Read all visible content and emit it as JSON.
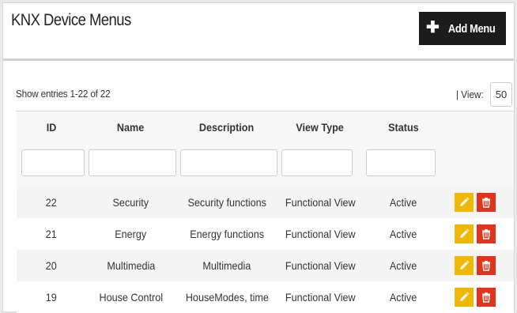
{
  "header": {
    "title": "KNX Device Menus",
    "add_button_label": "Add Menu"
  },
  "toolbar": {
    "entries_info": "Show entries 1-22 of 22",
    "view_label": "| View:",
    "view_value": "50"
  },
  "table": {
    "columns": [
      "ID",
      "Name",
      "Description",
      "View Type",
      "Status"
    ],
    "rows": [
      {
        "id": "22",
        "name": "Security",
        "description": "Security functions",
        "view_type": "Functional View",
        "status": "Active"
      },
      {
        "id": "21",
        "name": "Energy",
        "description": "Energy functions",
        "view_type": "Functional View",
        "status": "Active"
      },
      {
        "id": "20",
        "name": "Multimedia",
        "description": "Multimedia",
        "view_type": "Functional View",
        "status": "Active"
      },
      {
        "id": "19",
        "name": "House Control",
        "description": "HouseModes, time",
        "view_type": "Functional View",
        "status": "Active"
      }
    ]
  },
  "icons": {
    "add": "plus-icon",
    "edit": "pencil-icon",
    "delete": "trash-icon"
  },
  "colors": {
    "add_button": "#1c1c1c",
    "edit_button": "#f0b800",
    "delete_button": "#e2331f"
  }
}
